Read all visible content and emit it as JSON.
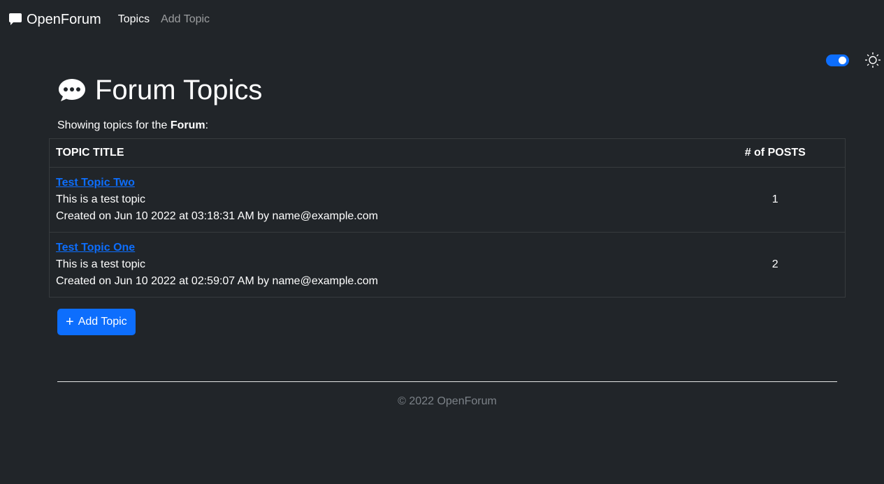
{
  "navbar": {
    "brand": "OpenForum",
    "links": [
      {
        "label": "Topics",
        "active": true
      },
      {
        "label": "Add Topic",
        "active": false
      }
    ]
  },
  "theme": {
    "toggle_on": true,
    "accent": "#0d6efd",
    "icon": "sun-icon"
  },
  "page": {
    "title": "Forum Topics",
    "subtitle_prefix": "Showing topics for the ",
    "subtitle_forum": "Forum",
    "subtitle_suffix": ":"
  },
  "table": {
    "headers": [
      "TOPIC TITLE",
      "# of POSTS"
    ],
    "rows": [
      {
        "title": "Test Topic Two",
        "description": "This is a test topic",
        "meta": "Created on Jun 10 2022 at 03:18:31 AM by name@example.com",
        "posts": "1"
      },
      {
        "title": "Test Topic One",
        "description": "This is a test topic",
        "meta": "Created on Jun 10 2022 at 02:59:07 AM by name@example.com",
        "posts": "2"
      }
    ]
  },
  "add_button": {
    "label": "Add Topic",
    "icon": "plus-icon"
  },
  "footer": {
    "text": "© 2022 OpenForum"
  },
  "colors": {
    "background": "#212529",
    "link": "#0d6efd",
    "muted": "#7c8288"
  }
}
